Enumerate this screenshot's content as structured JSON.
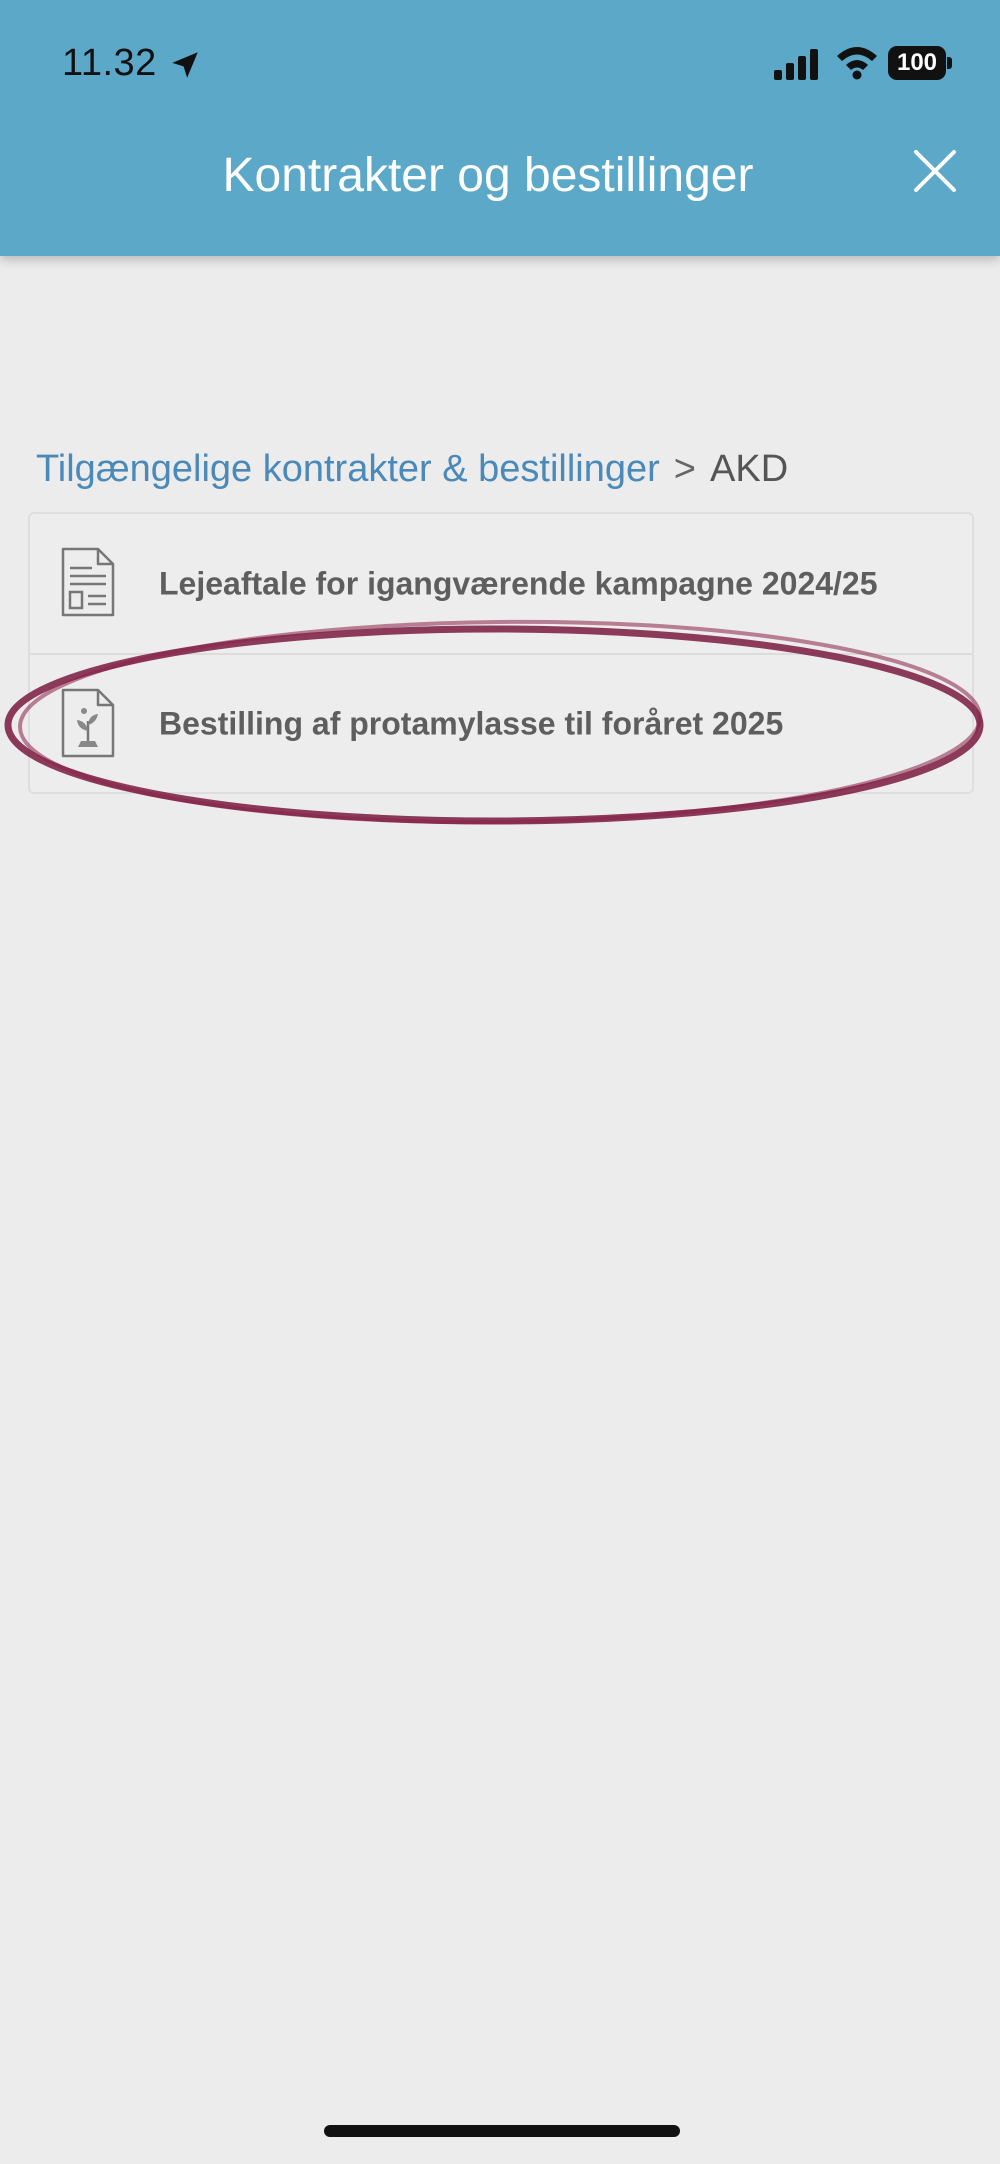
{
  "status_bar": {
    "time": "11.32",
    "battery": "100",
    "icons": [
      "location-arrow-icon",
      "cellular-signal-icon",
      "wifi-icon",
      "battery-icon"
    ]
  },
  "header": {
    "title": "Kontrakter og bestillinger",
    "background_color": "#5ba8c9",
    "close_icon": "close-icon"
  },
  "breadcrumb": {
    "parent": "Tilgængelige kontrakter & bestillinger",
    "separator": ">",
    "current": "AKD"
  },
  "list": {
    "items": [
      {
        "label": "Lejeaftale for igangværende kampagne 2024/25",
        "icon": "contract-document-icon"
      },
      {
        "label": "Bestilling af protamylasse til foråret 2025",
        "icon": "plant-document-icon"
      }
    ]
  },
  "annotation": {
    "type": "hand-drawn-ellipse",
    "color": "#7a1a3f"
  }
}
